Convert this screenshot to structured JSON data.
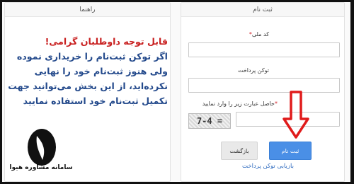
{
  "panels": {
    "guide": {
      "title": "راهنما"
    },
    "register": {
      "title": "ثبت نام"
    }
  },
  "notice": {
    "title": "قابل توجه داوطلبان گرامی!",
    "body": "اگر توکن ثبت‌نام را خریداری نموده ولی هنوز ثبت‌نام خود را نهایی نکرده‌اید، از این بخش می‌توانید جهت تکمیل ثبت‌نام خود استفاده نمایید"
  },
  "form": {
    "national_code": {
      "label": "کد ملی",
      "required_mark": "*",
      "value": ""
    },
    "tracking_code": {
      "label": "توکن پرداخت",
      "value": ""
    },
    "captcha": {
      "label": "حاصل عبارت زیر را وارد نمایید",
      "required_mark": "*",
      "image_text": "7-4 =",
      "value": ""
    },
    "buttons": {
      "submit": "ثبت نام",
      "back": "بازگشت"
    },
    "recovery_link": "بازیابی توکن پرداخت"
  },
  "watermark": {
    "text": "سامانه مشاوره هیوا"
  },
  "colors": {
    "notice_title": "#c81f1f",
    "notice_body": "#244a8c",
    "primary_button": "#4a8fe6",
    "arrow": "#e01b1b"
  }
}
